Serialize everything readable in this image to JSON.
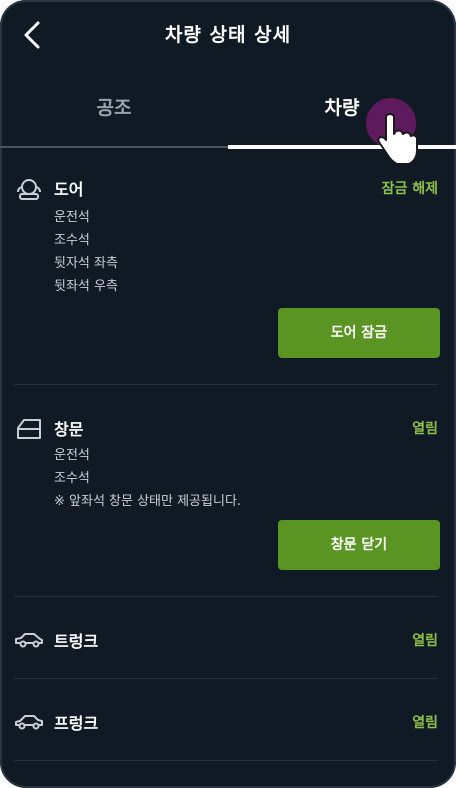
{
  "header": {
    "title": "차량 상태 상세"
  },
  "tabs": [
    {
      "label": "공조"
    },
    {
      "label": "차량"
    }
  ],
  "door": {
    "title": "도어",
    "status": "잠금 해제",
    "items": [
      "운전석",
      "조수석",
      "뒷자석 좌측",
      "뒷좌석 우측"
    ],
    "button_label": "도어 잠금"
  },
  "window": {
    "title": "창문",
    "status": "열림",
    "items": [
      "운전석",
      "조수석"
    ],
    "note": "※ 앞좌석 창문 상태만 제공됩니다.",
    "button_label": "창문 닫기"
  },
  "trunk": {
    "title": "트렁크",
    "status": "열림"
  },
  "frunk": {
    "title": "프렁크",
    "status": "열림"
  },
  "colors": {
    "background": "#0f1a24",
    "accent_green": "#5a9423",
    "status_green": "#8fbf4a",
    "touch_indicator": "#5e1a5c"
  }
}
